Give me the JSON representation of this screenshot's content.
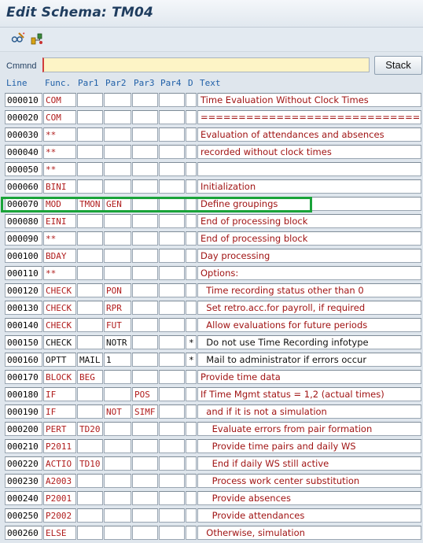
{
  "window": {
    "title": "Edit Schema: TM04"
  },
  "toolbar": {
    "icons": [
      {
        "name": "display-change-icon",
        "symbol": "glasses-pencil"
      },
      {
        "name": "hierarchy-icon",
        "symbol": "structure-tree"
      }
    ]
  },
  "command": {
    "label": "Cmmnd",
    "value": "",
    "stack_label": "Stack"
  },
  "headers": {
    "line": "Line",
    "func": "Func.",
    "par1": "Par1",
    "par2": "Par2",
    "par3": "Par3",
    "par4": "Par4",
    "d": "D",
    "text": "Text"
  },
  "rows": [
    {
      "line": "000010",
      "func": "COM",
      "par1": "",
      "par2": "",
      "par3": "",
      "par4": "",
      "d": "",
      "text": "Time Evaluation Without Clock Times"
    },
    {
      "line": "000020",
      "func": "COM",
      "par1": "",
      "par2": "",
      "par3": "",
      "par4": "",
      "d": "",
      "text": "==============================="
    },
    {
      "line": "000030",
      "func": "**",
      "par1": "",
      "par2": "",
      "par3": "",
      "par4": "",
      "d": "",
      "text": "Evaluation of attendances and absences"
    },
    {
      "line": "000040",
      "func": "**",
      "par1": "",
      "par2": "",
      "par3": "",
      "par4": "",
      "d": "",
      "text": "recorded without clock times"
    },
    {
      "line": "000050",
      "func": "**",
      "par1": "",
      "par2": "",
      "par3": "",
      "par4": "",
      "d": "",
      "text": ""
    },
    {
      "line": "000060",
      "func": "BINI",
      "par1": "",
      "par2": "",
      "par3": "",
      "par4": "",
      "d": "",
      "text": "Initialization"
    },
    {
      "line": "000070",
      "func": "MOD",
      "par1": "TMON",
      "par2": "GEN",
      "par3": "",
      "par4": "",
      "d": "",
      "text": "Define groupings"
    },
    {
      "line": "000080",
      "func": "EINI",
      "par1": "",
      "par2": "",
      "par3": "",
      "par4": "",
      "d": "",
      "text": "End of processing block"
    },
    {
      "line": "000090",
      "func": "**",
      "par1": "",
      "par2": "",
      "par3": "",
      "par4": "",
      "d": "",
      "text": "End of processing block"
    },
    {
      "line": "000100",
      "func": "BDAY",
      "par1": "",
      "par2": "",
      "par3": "",
      "par4": "",
      "d": "",
      "text": "Day processing"
    },
    {
      "line": "000110",
      "func": "**",
      "par1": "",
      "par2": "",
      "par3": "",
      "par4": "",
      "d": "",
      "text": "Options:"
    },
    {
      "line": "000120",
      "func": "CHECK",
      "par1": "",
      "par2": "PON",
      "par3": "",
      "par4": "",
      "d": "",
      "text": "  Time recording status other than 0"
    },
    {
      "line": "000130",
      "func": "CHECK",
      "par1": "",
      "par2": "RPR",
      "par3": "",
      "par4": "",
      "d": "",
      "text": "  Set retro.acc.for payroll, if required"
    },
    {
      "line": "000140",
      "func": "CHECK",
      "par1": "",
      "par2": "FUT",
      "par3": "",
      "par4": "",
      "d": "",
      "text": "  Allow evaluations for future periods"
    },
    {
      "line": "000150",
      "func": "CHECK",
      "par1": "",
      "par2": "NOTR",
      "par3": "",
      "par4": "",
      "d": "*",
      "text": "  Do not use Time Recording infotype",
      "inactive": true
    },
    {
      "line": "000160",
      "func": "OPTT",
      "par1": "MAIL",
      "par2": "1",
      "par3": "",
      "par4": "",
      "d": "*",
      "text": "  Mail to administrator if errors occur",
      "inactive": true
    },
    {
      "line": "000170",
      "func": "BLOCK",
      "par1": "BEG",
      "par2": "",
      "par3": "",
      "par4": "",
      "d": "",
      "text": "Provide time data"
    },
    {
      "line": "000180",
      "func": "IF",
      "par1": "",
      "par2": "",
      "par3": "POS",
      "par4": "",
      "d": "",
      "text": "If Time Mgmt status = 1,2 (actual times)"
    },
    {
      "line": "000190",
      "func": "IF",
      "par1": "",
      "par2": "NOT",
      "par3": "SIMF",
      "par4": "",
      "d": "",
      "text": "  and if it is not a simulation"
    },
    {
      "line": "000200",
      "func": "PERT",
      "par1": "TD20",
      "par2": "",
      "par3": "",
      "par4": "",
      "d": "",
      "text": "    Evaluate errors from pair formation"
    },
    {
      "line": "000210",
      "func": "P2011",
      "par1": "",
      "par2": "",
      "par3": "",
      "par4": "",
      "d": "",
      "text": "    Provide time pairs and daily WS"
    },
    {
      "line": "000220",
      "func": "ACTIO",
      "par1": "TD10",
      "par2": "",
      "par3": "",
      "par4": "",
      "d": "",
      "text": "    End if daily WS still active"
    },
    {
      "line": "000230",
      "func": "A2003",
      "par1": "",
      "par2": "",
      "par3": "",
      "par4": "",
      "d": "",
      "text": "    Process work center substitution"
    },
    {
      "line": "000240",
      "func": "P2001",
      "par1": "",
      "par2": "",
      "par3": "",
      "par4": "",
      "d": "",
      "text": "    Provide absences"
    },
    {
      "line": "000250",
      "func": "P2002",
      "par1": "",
      "par2": "",
      "par3": "",
      "par4": "",
      "d": "",
      "text": "    Provide attendances"
    },
    {
      "line": "000260",
      "func": "ELSE",
      "par1": "",
      "par2": "",
      "par3": "",
      "par4": "",
      "d": "",
      "text": "  Otherwise, simulation"
    }
  ],
  "colors": {
    "highlight": "#1aa339",
    "function_text": "#b01d1d",
    "header": "#2060a8"
  }
}
